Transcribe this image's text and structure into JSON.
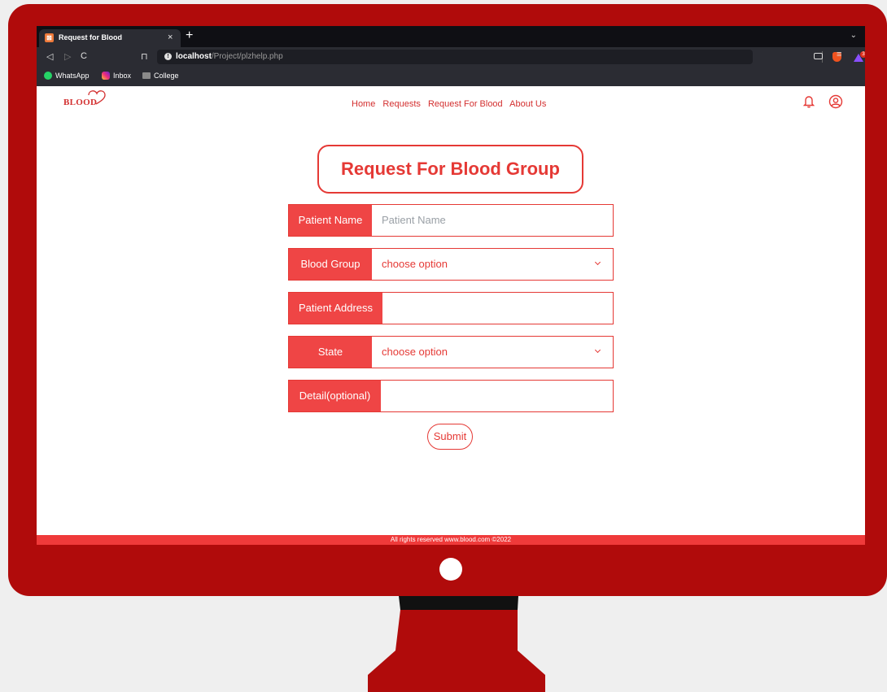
{
  "browser": {
    "tab_title": "Request for Blood",
    "tab_favicon": "xampp-icon",
    "url_host": "localhost",
    "url_path": "/Project/plzhelp.php",
    "rewards_badge_count": "3",
    "bookmarks": [
      {
        "label": "WhatsApp",
        "icon": "whatsapp-icon"
      },
      {
        "label": "Inbox",
        "icon": "instagram-icon"
      },
      {
        "label": "College",
        "icon": "folder-icon"
      }
    ]
  },
  "site": {
    "logo_text": "BLOOD",
    "nav": [
      "Home",
      "Requests",
      "Request For Blood",
      "About Us"
    ],
    "icons": [
      "bell-icon",
      "user-icon"
    ]
  },
  "form": {
    "title": "Request For Blood Group",
    "fields": [
      {
        "label": "Patient Name",
        "placeholder": "Patient Name",
        "value": "",
        "type": "text"
      },
      {
        "label": "Blood Group",
        "value": "choose option",
        "type": "select"
      },
      {
        "label": "Patient Address",
        "value": "",
        "type": "text"
      },
      {
        "label": "State",
        "value": "choose option",
        "type": "select"
      },
      {
        "label": "Detail(optional)",
        "value": "",
        "type": "text"
      }
    ],
    "submit_label": "Submit"
  },
  "footer": {
    "text": "All rights reserved www.blood.com ©2022"
  },
  "colors": {
    "brand_red": "#e53935",
    "monitor_red": "#b00b0b"
  }
}
